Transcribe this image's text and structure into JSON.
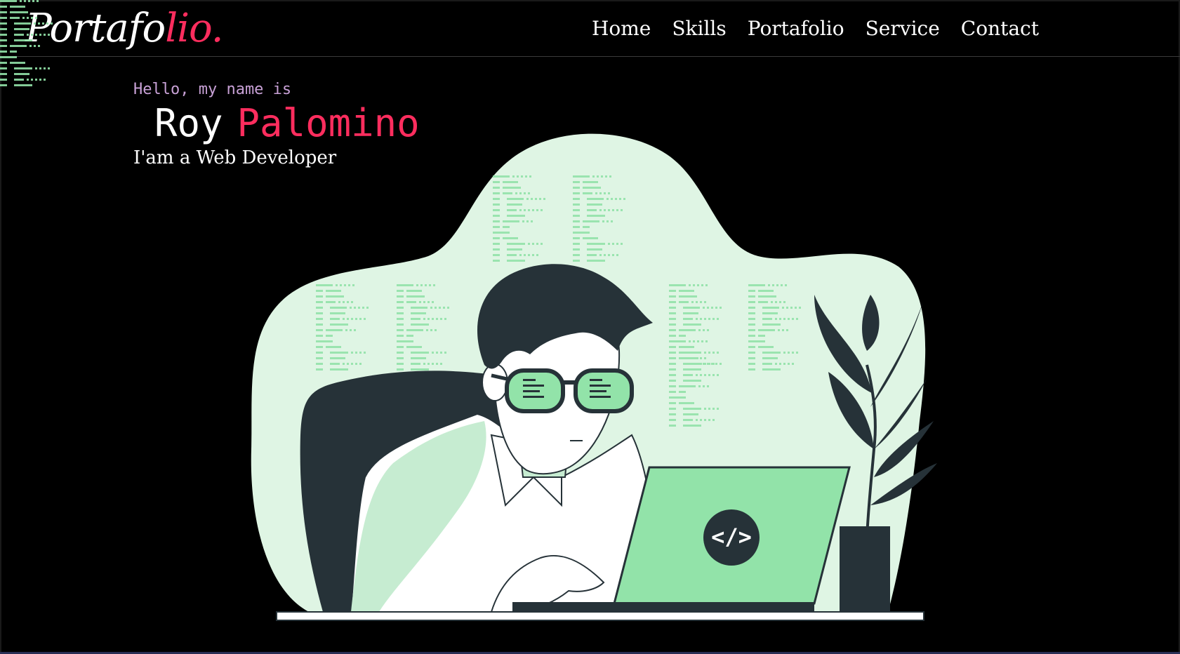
{
  "header": {
    "logo_part1": "Portafo",
    "logo_part2": "lio."
  },
  "nav": {
    "items": [
      {
        "label": "Home"
      },
      {
        "label": "Skills"
      },
      {
        "label": "Portafolio"
      },
      {
        "label": "Service"
      },
      {
        "label": "Contact"
      }
    ]
  },
  "hero": {
    "greeting": "Hello, my name is",
    "first_name": "Roy",
    "last_name": "Palomino",
    "role": "I'am a Web Developer"
  },
  "illustration": {
    "laptop_code_symbol": "</>",
    "icon": "developer-at-laptop-illustration"
  },
  "colors": {
    "background": "#000000",
    "accent": "#ff2d5e",
    "greeting": "#c8a1d6",
    "blob": "#dff5e4",
    "laptop_green": "#92e3a9",
    "dark": "#263238"
  }
}
